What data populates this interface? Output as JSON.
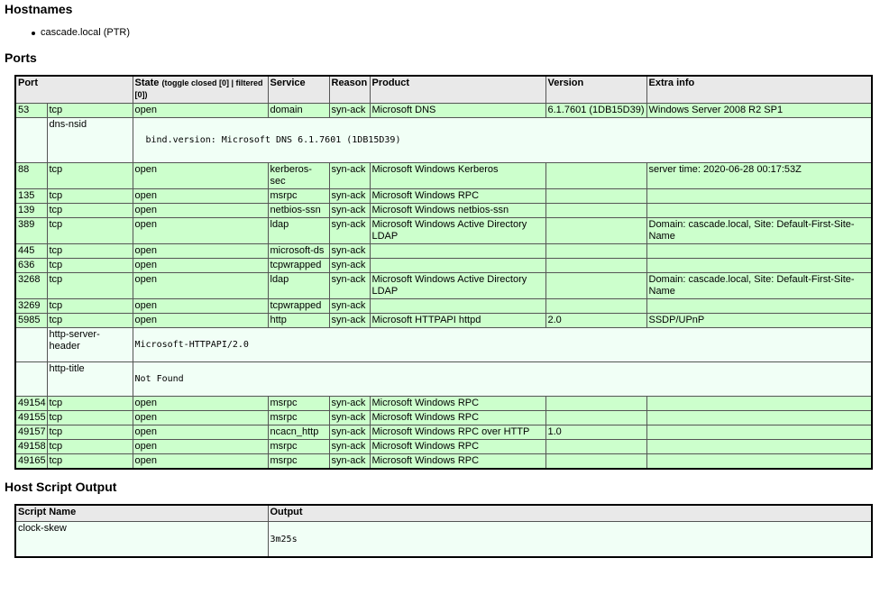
{
  "hostnames": {
    "title": "Hostnames",
    "items": [
      "cascade.local (PTR)"
    ]
  },
  "ports": {
    "title": "Ports",
    "headers": {
      "port": "Port",
      "state": "State",
      "state_toggle_open": "(toggle ",
      "state_toggle_closed": "closed [0]",
      "state_sep": " | ",
      "state_toggle_filtered": "filtered [0]",
      "state_close": ")",
      "service": "Service",
      "reason": "Reason",
      "product": "Product",
      "version": "Version",
      "extra": "Extra info"
    },
    "rows": [
      {
        "port": "53",
        "proto": "tcp",
        "state": "open",
        "service": "domain",
        "reason": "syn-ack",
        "product": "Microsoft DNS",
        "version": "6.1.7601 (1DB15D39)",
        "extra": "Windows Server 2008 R2 SP1"
      },
      {
        "port": "88",
        "proto": "tcp",
        "state": "open",
        "service": "kerberos-sec",
        "reason": "syn-ack",
        "product": "Microsoft Windows Kerberos",
        "version": "",
        "extra": "server time: 2020-06-28 00:17:53Z"
      },
      {
        "port": "135",
        "proto": "tcp",
        "state": "open",
        "service": "msrpc",
        "reason": "syn-ack",
        "product": "Microsoft Windows RPC",
        "version": "",
        "extra": ""
      },
      {
        "port": "139",
        "proto": "tcp",
        "state": "open",
        "service": "netbios-ssn",
        "reason": "syn-ack",
        "product": "Microsoft Windows netbios-ssn",
        "version": "",
        "extra": ""
      },
      {
        "port": "389",
        "proto": "tcp",
        "state": "open",
        "service": "ldap",
        "reason": "syn-ack",
        "product": "Microsoft Windows Active Directory LDAP",
        "version": "",
        "extra": "Domain: cascade.local, Site: Default-First-Site-Name"
      },
      {
        "port": "445",
        "proto": "tcp",
        "state": "open",
        "service": "microsoft-ds",
        "reason": "syn-ack",
        "product": "",
        "version": "",
        "extra": ""
      },
      {
        "port": "636",
        "proto": "tcp",
        "state": "open",
        "service": "tcpwrapped",
        "reason": "syn-ack",
        "product": "",
        "version": "",
        "extra": ""
      },
      {
        "port": "3268",
        "proto": "tcp",
        "state": "open",
        "service": "ldap",
        "reason": "syn-ack",
        "product": "Microsoft Windows Active Directory LDAP",
        "version": "",
        "extra": "Domain: cascade.local, Site: Default-First-Site-Name"
      },
      {
        "port": "3269",
        "proto": "tcp",
        "state": "open",
        "service": "tcpwrapped",
        "reason": "syn-ack",
        "product": "",
        "version": "",
        "extra": ""
      },
      {
        "port": "5985",
        "proto": "tcp",
        "state": "open",
        "service": "http",
        "reason": "syn-ack",
        "product": "Microsoft HTTPAPI httpd",
        "version": "2.0",
        "extra": "SSDP/UPnP"
      },
      {
        "port": "49154",
        "proto": "tcp",
        "state": "open",
        "service": "msrpc",
        "reason": "syn-ack",
        "product": "Microsoft Windows RPC",
        "version": "",
        "extra": ""
      },
      {
        "port": "49155",
        "proto": "tcp",
        "state": "open",
        "service": "msrpc",
        "reason": "syn-ack",
        "product": "Microsoft Windows RPC",
        "version": "",
        "extra": ""
      },
      {
        "port": "49157",
        "proto": "tcp",
        "state": "open",
        "service": "ncacn_http",
        "reason": "syn-ack",
        "product": "Microsoft Windows RPC over HTTP",
        "version": "1.0",
        "extra": ""
      },
      {
        "port": "49158",
        "proto": "tcp",
        "state": "open",
        "service": "msrpc",
        "reason": "syn-ack",
        "product": "Microsoft Windows RPC",
        "version": "",
        "extra": ""
      },
      {
        "port": "49165",
        "proto": "tcp",
        "state": "open",
        "service": "msrpc",
        "reason": "syn-ack",
        "product": "Microsoft Windows RPC",
        "version": "",
        "extra": ""
      }
    ],
    "scripts": {
      "dns_nsid": {
        "name": "dns-nsid",
        "output": "bind.version: Microsoft DNS 6.1.7601 (1DB15D39)"
      },
      "http_server_header": {
        "name": "http-server-header",
        "output": "Microsoft-HTTPAPI/2.0"
      },
      "http_title": {
        "name": "http-title",
        "output": "Not Found"
      }
    }
  },
  "host_script": {
    "title": "Host Script Output",
    "headers": {
      "name": "Script Name",
      "output": "Output"
    },
    "rows": [
      {
        "name": "clock-skew",
        "output": "3m25s"
      }
    ]
  },
  "colors": {
    "port_row_bg": "#ccffcc",
    "script_row_bg": "#f1fff6",
    "header_bg": "#e9e9e9"
  }
}
